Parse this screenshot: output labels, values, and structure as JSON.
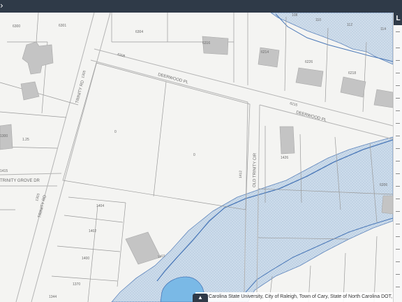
{
  "map": {
    "streets": {
      "deerwood_pl_west": "DEERWOOD PL",
      "deerwood_pl_east": "DEERWOOD PL",
      "trinity_rd_north": "TRINITY RD",
      "trinity_rd_south": "TRINITY RD",
      "old_trinity_cir": "OLD TRINITY CIR",
      "trinity_grove_dr": "TRINITY GROVE DR"
    },
    "parcel_numbers": {
      "n6300": "6300",
      "n6301": "6301",
      "n6304": "6304",
      "n6308": "6308",
      "n6214": "6214",
      "n6226": "6226",
      "n6218": "6218",
      "n108": "108",
      "n110": "110",
      "n112": "112",
      "n114": "114",
      "n6316": "6316",
      "n1412": "1412",
      "n1426": "1426",
      "n1404": "1404",
      "n1402": "1402",
      "n1400": "1400",
      "n1370": "1370",
      "n1344": "1344",
      "n1300": "1300",
      "n1415": "1415",
      "n0a": "0",
      "n0b": "0",
      "n1401": "1401",
      "n6215": "6215",
      "n6206": "6206",
      "n1305": "1305",
      "n1303": "1303",
      "n125": "1.25"
    },
    "colors": {
      "background": "#f4f4f2",
      "floodplain": "#c8d9ea",
      "stream": "#4a78b8",
      "pond": "#7ab9e6",
      "building": "#c4c4c4",
      "road_edge": "#b4b4b4",
      "parcel_line": "#9a9a9a"
    }
  },
  "panel": {
    "header_label": "L"
  },
  "top_bar": {
    "glyph": "›"
  },
  "attribution": {
    "text": "North Carolina State University, City of Raleigh, Town of Cary, State of North Carolina DOT, Esri, H",
    "toggle_icon": "chevron-up-icon",
    "toggle_glyph": "▲"
  }
}
